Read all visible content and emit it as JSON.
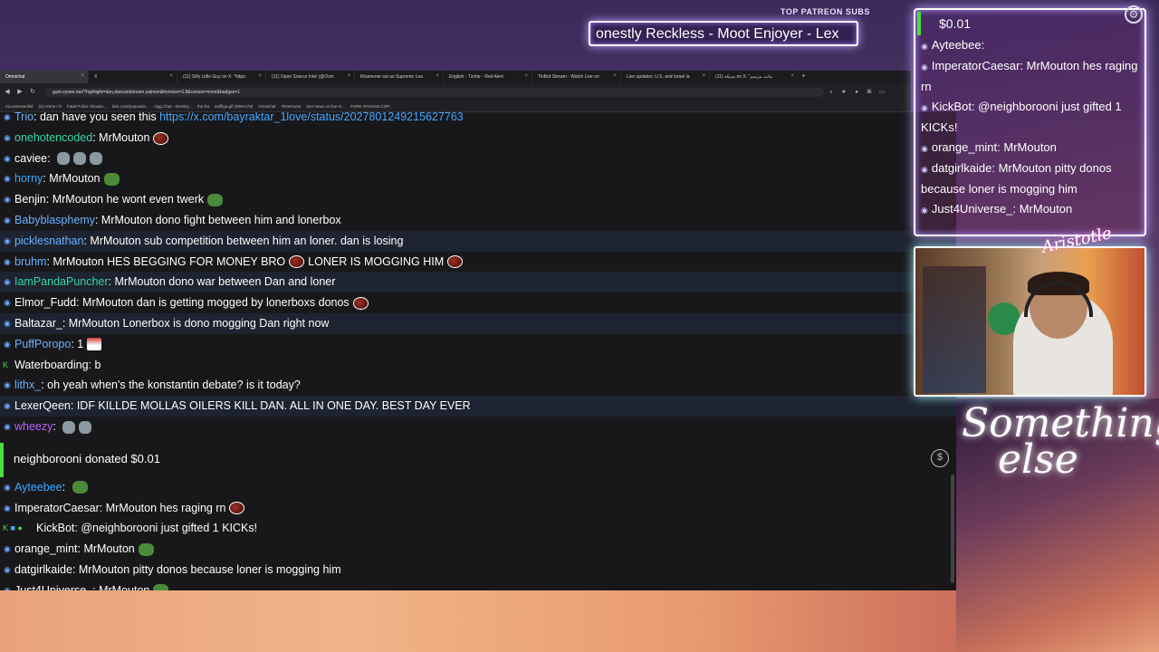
{
  "overlay": {
    "patreon_label": "TOP PATREON SUBS",
    "patreon_ticker": "onestly Reckless - Moot Enjoyer - Lex",
    "sig_small": "Aristotle",
    "sig_large_1": "Something",
    "sig_large_2": "else"
  },
  "browser": {
    "tabs": [
      {
        "label": "Omnichat",
        "active": true
      },
      {
        "label": "X",
        "active": false
      },
      {
        "label": "(11) Silly Little Guy on X: \"https:",
        "active": false
      },
      {
        "label": "(11) Open Source Intel (@Osin",
        "active": false
      },
      {
        "label": "Khamenei out as Supreme Lea",
        "active": false
      },
      {
        "label": "English - Tzofar - Red Alert",
        "active": false
      },
      {
        "label": "TinBot Stream - Watch Live on",
        "active": false
      },
      {
        "label": "Live updates: U.S. and Israel la",
        "active": false
      },
      {
        "label": "(11) مدیکه on X: \"ماتت مرسم",
        "active": false
      }
    ],
    "url": "gum.vynee.me/?highlight=dan,dancantstream,salmon&fontsize=3.8&censor=none&badges=1",
    "bookmarks": [
      "r/Livestreamfail",
      "(3) Home / X",
      "Fatal Police Shootin...",
      "kick.com/popout/w...",
      "Ogg Chat - Destiny...",
      "the list",
      "anifliga.gif (399×278)",
      "Omnichat",
      "TimeGuesr",
      "iran news on live m...",
      "PURE AFGHAN COP..."
    ]
  },
  "chat": {
    "first_row_user": "Trio",
    "first_row_text": "dan have you seen this",
    "first_row_link": "https://x.com/bayraktar_1love/status/2027801249215627763",
    "rows": [
      {
        "user": "onehotencoded",
        "color": "#3ad6a4",
        "text": "MrMouton",
        "emote": "red",
        "alt": false
      },
      {
        "user": "caviee",
        "color": "#ffffff",
        "text": "",
        "emote": "grey",
        "alt": false
      },
      {
        "user": "horny",
        "color": "#3aa8ff",
        "text": "MrMouton",
        "emote": "frog",
        "alt": false
      },
      {
        "user": "Benjin",
        "color": "#ffffff",
        "text": "MrMouton he wont even twerk",
        "emote": "frog",
        "alt": false
      },
      {
        "user": "Babyblasphemy",
        "color": "#6ab0ff",
        "text": "MrMouton dono fight between him and lonerbox",
        "emote": "",
        "alt": false
      },
      {
        "user": "picklesnathan",
        "color": "#6ab0ff",
        "text": "MrMouton sub competition between him an loner. dan is losing",
        "emote": "",
        "alt": true
      },
      {
        "user": "bruhm",
        "color": "#6ab0ff",
        "text": "MrMouton HES BEGGING FOR MONEY BRO",
        "emote": "red",
        "text2": "LONER IS MOGGING HIM",
        "emote2": "red",
        "alt": false
      },
      {
        "user": "IamPandaPuncher",
        "color": "#3ad6a4",
        "text": "MrMouton dono war between Dan and loner",
        "emote": "",
        "alt": true
      },
      {
        "user": "Elmor_Fudd",
        "color": "#ffffff",
        "text": "MrMouton dan is getting mogged by lonerboxs donos",
        "emote": "red",
        "alt": false
      },
      {
        "user": "Baltazar_",
        "color": "#ffffff",
        "text": "MrMouton Lonerbox is dono mogging Dan right now",
        "emote": "",
        "alt": true
      },
      {
        "user": "PuffPoropo",
        "color": "#6ab0ff",
        "text": "1",
        "emote": "flag",
        "alt": false
      },
      {
        "user": "Waterboarding",
        "color": "#ffffff",
        "text": "b",
        "emote": "",
        "alt": false,
        "kickbadge": true
      },
      {
        "user": "lithx_",
        "color": "#6ab0ff",
        "text": "oh yeah when's the konstantin debate? is it today?",
        "emote": "",
        "alt": false
      },
      {
        "user": "LexerQeen",
        "color": "#ffffff",
        "text": "IDF KILLDE MOLLAS OILERS KILL DAN. ALL IN ONE DAY. BEST DAY EVER",
        "emote": "",
        "alt": true
      },
      {
        "user": "wheezy",
        "color": "#c060ff",
        "text": "",
        "emote": "grey",
        "alt": false
      }
    ],
    "donation_user": "neighborooni",
    "donation_text": "donated $0.01",
    "rows_after": [
      {
        "user": "Ayteebee",
        "color": "#3aa8ff",
        "text": "",
        "emote": "frog",
        "alt": false
      },
      {
        "user": "ImperatorCaesar",
        "color": "#ffffff",
        "text": "MrMouton hes raging rn",
        "emote": "red",
        "alt": false
      },
      {
        "user": "KickBot",
        "color": "#ffffff",
        "text": "@neighborooni just gifted 1 KICKs!",
        "emote": "",
        "alt": false,
        "kickbot": true
      },
      {
        "user": "orange_mint",
        "color": "#ffffff",
        "text": "MrMouton",
        "emote": "frog",
        "alt": false
      },
      {
        "user": "datgirlkaide",
        "color": "#ffffff",
        "text": "MrMouton pitty donos because loner is mogging him",
        "emote": "",
        "alt": false
      },
      {
        "user": "Just4Universe_",
        "color": "#ffffff",
        "text": "MrMouton",
        "emote": "frog",
        "alt": false
      }
    ]
  },
  "overlay_chat": {
    "donation_amount": "$0.01",
    "rows": [
      {
        "user": "Ayteebee",
        "text": ""
      },
      {
        "user": "ImperatorCaesar",
        "text": "MrMouton hes raging rn"
      },
      {
        "user": "KickBot",
        "text": "@neighborooni just gifted 1 KICKs!"
      },
      {
        "user": "orange_mint",
        "text": "MrMouton"
      },
      {
        "user": "datgirlkaide",
        "text": "MrMouton pitty donos because loner is mogging him"
      },
      {
        "user": "Just4Universe_",
        "text": "MrMouton"
      }
    ]
  },
  "icons": {
    "sub_badge": "speech-bubble-icon",
    "dollar": "$",
    "gear": "⚙"
  }
}
